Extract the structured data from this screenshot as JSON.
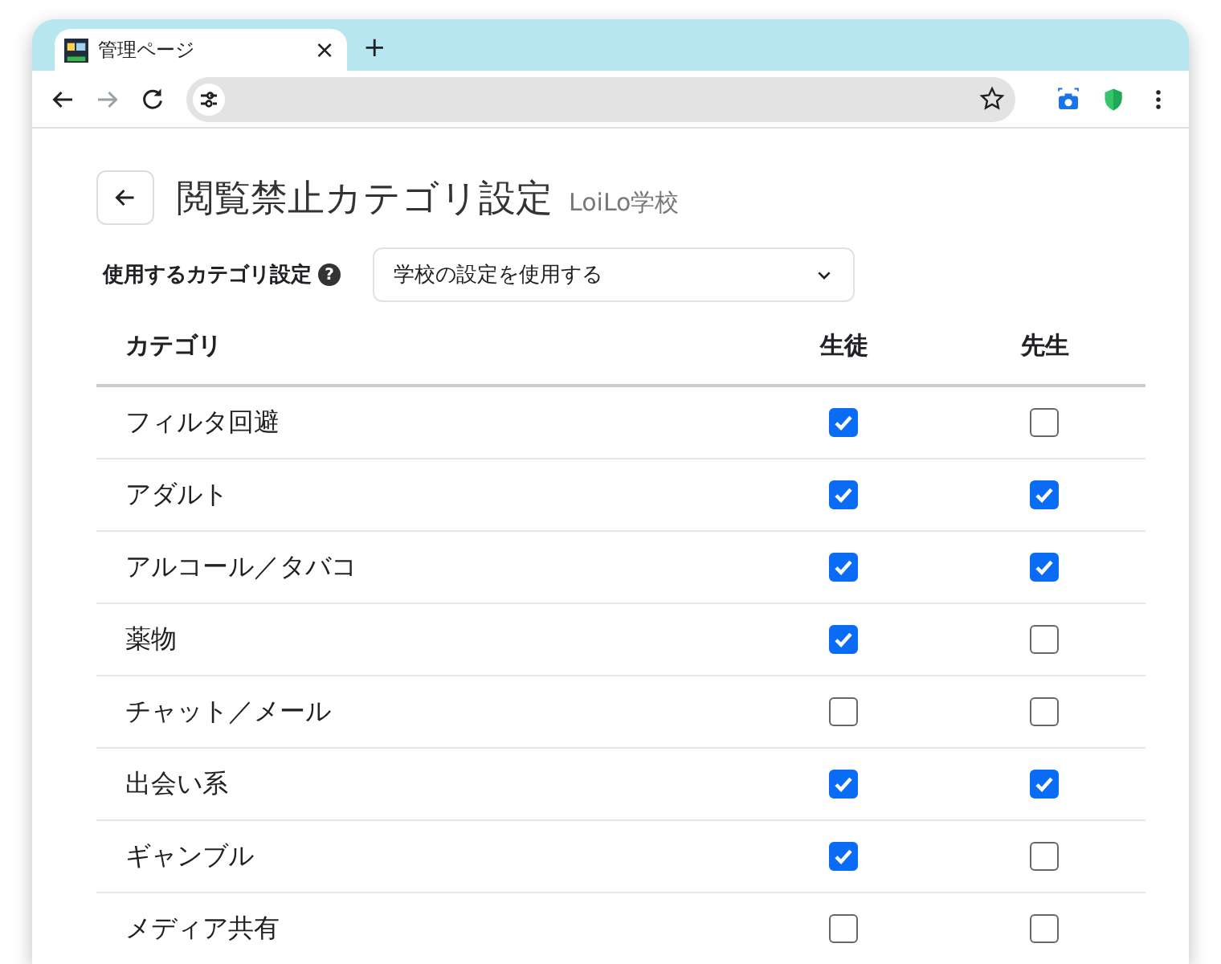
{
  "browser": {
    "tab_title": "管理ページ",
    "tab_close": "×",
    "new_tab": "+"
  },
  "page": {
    "title": "閲覧禁止カテゴリ設定",
    "school": "LoiLo学校",
    "setting_label": "使用するカテゴリ設定",
    "help": "?",
    "setting_value": "学校の設定を使用する"
  },
  "table": {
    "columns": [
      "カテゴリ",
      "生徒",
      "先生"
    ],
    "rows": [
      {
        "category": "フィルタ回避",
        "student": true,
        "teacher": false
      },
      {
        "category": "アダルト",
        "student": true,
        "teacher": true
      },
      {
        "category": "アルコール／タバコ",
        "student": true,
        "teacher": true
      },
      {
        "category": "薬物",
        "student": true,
        "teacher": false
      },
      {
        "category": "チャット／メール",
        "student": false,
        "teacher": false
      },
      {
        "category": "出会い系",
        "student": true,
        "teacher": true
      },
      {
        "category": "ギャンブル",
        "student": true,
        "teacher": false
      },
      {
        "category": "メディア共有",
        "student": false,
        "teacher": false
      }
    ]
  }
}
